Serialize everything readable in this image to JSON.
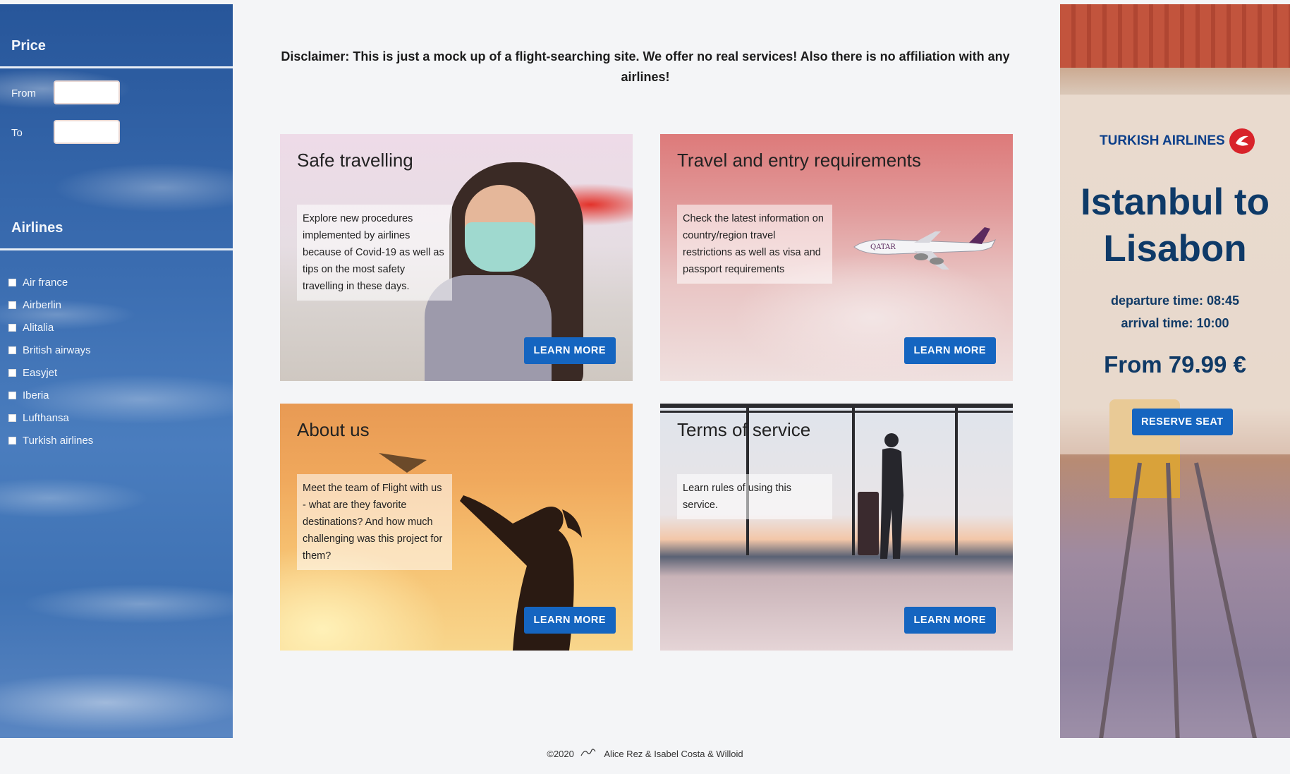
{
  "sidebar": {
    "price_heading": "Price",
    "from_label": "From",
    "to_label": "To",
    "from_value": "",
    "to_value": "",
    "airlines_heading": "Airlines",
    "airlines": [
      {
        "label": "Air france",
        "checked": false
      },
      {
        "label": "Airberlin",
        "checked": false
      },
      {
        "label": "Alitalia",
        "checked": false
      },
      {
        "label": "British airways",
        "checked": false
      },
      {
        "label": "Easyjet",
        "checked": false
      },
      {
        "label": "Iberia",
        "checked": false
      },
      {
        "label": "Lufthansa",
        "checked": false
      },
      {
        "label": "Turkish airlines",
        "checked": false
      }
    ]
  },
  "main": {
    "disclaimer": "Disclaimer: This is just a mock up of a flight-searching site. We offer no real services! Also there is no affiliation with any airlines!",
    "cards": [
      {
        "title": "Safe travelling",
        "text": "Explore new procedures implemented by airlines because of Covid-19 as well as tips on the most safety travelling in these days.",
        "button": "LEARN MORE"
      },
      {
        "title": "Travel and entry requirements",
        "text": "Check the latest information on country/region travel restrictions as well as visa and passport requirements",
        "button": "LEARN MORE"
      },
      {
        "title": "About us",
        "text": "Meet the team of Flight with us - what are they favorite destinations? And how much challenging was this project for them?",
        "button": "LEARN MORE"
      },
      {
        "title": "Terms of service",
        "text": "Learn rules of using this service.",
        "button": "LEARN MORE"
      }
    ]
  },
  "promo": {
    "airline_brand": "TURKISH AIRLINES",
    "route": "Istanbul to Lisabon",
    "departure": "departure time: 08:45",
    "arrival": "arrival time: 10:00",
    "price": "From 79.99 €",
    "button": "RESERVE SEAT"
  },
  "footer": {
    "copyright": "©2020",
    "authors": "Alice Rez & Isabel Costa & Willoid"
  },
  "colors": {
    "accent_button": "#1565c0",
    "heading_navy": "#0e3a68",
    "brand_red": "#d8232a"
  }
}
